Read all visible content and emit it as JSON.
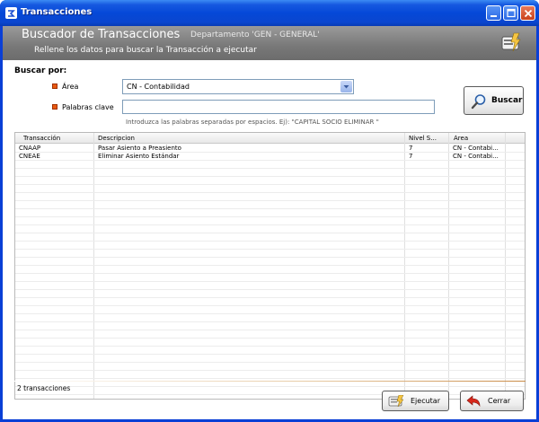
{
  "window": {
    "title": "Transacciones"
  },
  "banner": {
    "title": "Buscador de Transacciones",
    "department": "Departamento 'GEN - GENERAL'",
    "subtitle": "Rellene los datos para buscar la Transacción a ejecutar"
  },
  "search": {
    "heading": "Buscar por:",
    "area_label": "Área",
    "area_value": "CN - Contabilidad",
    "keywords_label": "Palabras clave",
    "keywords_value": "",
    "hint": "Introduzca las palabras separadas por espacios. Ej): \"CAPITAL SOCIO ELIMINAR \"",
    "search_button": "Buscar"
  },
  "table": {
    "columns": [
      "Transacción",
      "Descripcion",
      "Nivel S...",
      "Área"
    ],
    "rows": [
      [
        "CNAAP",
        "Pasar Asiento a Preasiento",
        "7",
        "CN - Contabi..."
      ],
      [
        "CNEAE",
        "Eliminar Asiento Estándar",
        "7",
        "CN - Contabi..."
      ]
    ]
  },
  "status": {
    "count_text": "2 transacciones"
  },
  "footer": {
    "execute_label": "Ejecutar",
    "close_label": "Cerrar"
  },
  "colors": {
    "titlebar": "#0548d8",
    "banner": "#787878",
    "bullet": "#e85a10"
  },
  "icons": [
    "app-icon",
    "minimize-icon",
    "maximize-icon",
    "close-icon",
    "transaction-card-icon",
    "magnifier-icon",
    "execute-icon",
    "back-arrow-icon",
    "dropdown-arrow-icon"
  ]
}
